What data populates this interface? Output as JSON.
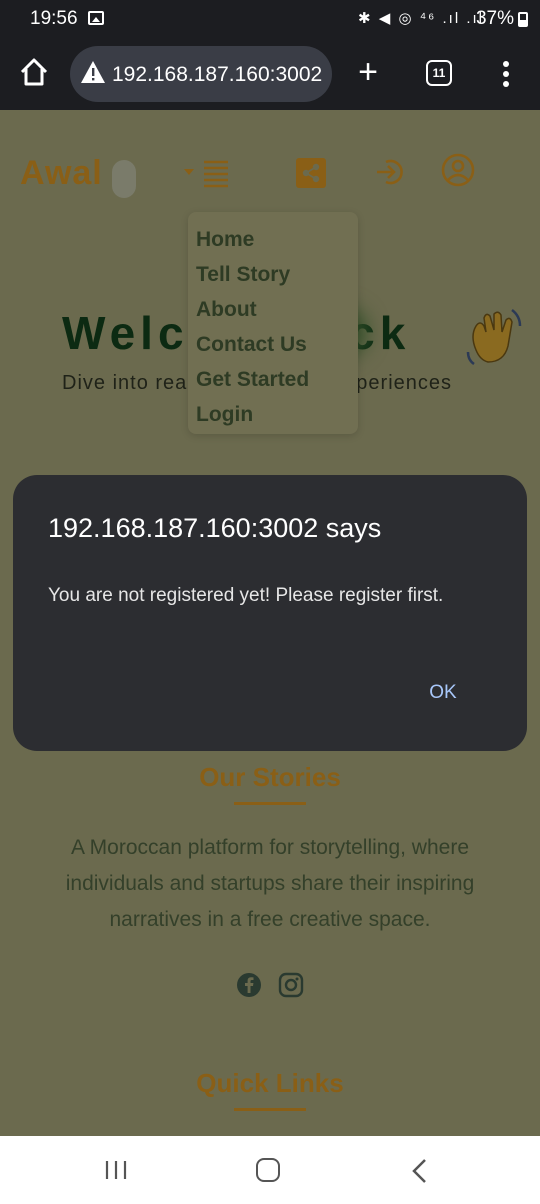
{
  "status_bar": {
    "time": "19:56",
    "icons_text": "✱ ◀ ◎ ⁴⁶ .ıl .ıl",
    "battery": "37%"
  },
  "browser": {
    "url": "192.168.187.160:3002",
    "tab_count": "11"
  },
  "page": {
    "logo": "Awal",
    "menu_items": [
      "Home",
      "Tell Story",
      "About",
      "Contact Us",
      "Get Started",
      "Login"
    ],
    "welcome_title": "Welc",
    "welcome_title_tail": "ack",
    "welcome_sub": "Dive into rea",
    "welcome_sub_tail": "xperiences",
    "stories_title": "Our Stories",
    "about_text": "A Moroccan platform for storytelling, where individuals and startups share their inspiring narratives in a free creative space.",
    "quick_links_title": "Quick Links"
  },
  "dialog": {
    "title": "192.168.187.160:3002 says",
    "message": "You are not registered yet! Please register first.",
    "ok_label": "OK"
  },
  "colors": {
    "accent": "#8a5f16",
    "dialog_bg": "#2c2d31",
    "dialog_button": "#a8c7fa"
  }
}
